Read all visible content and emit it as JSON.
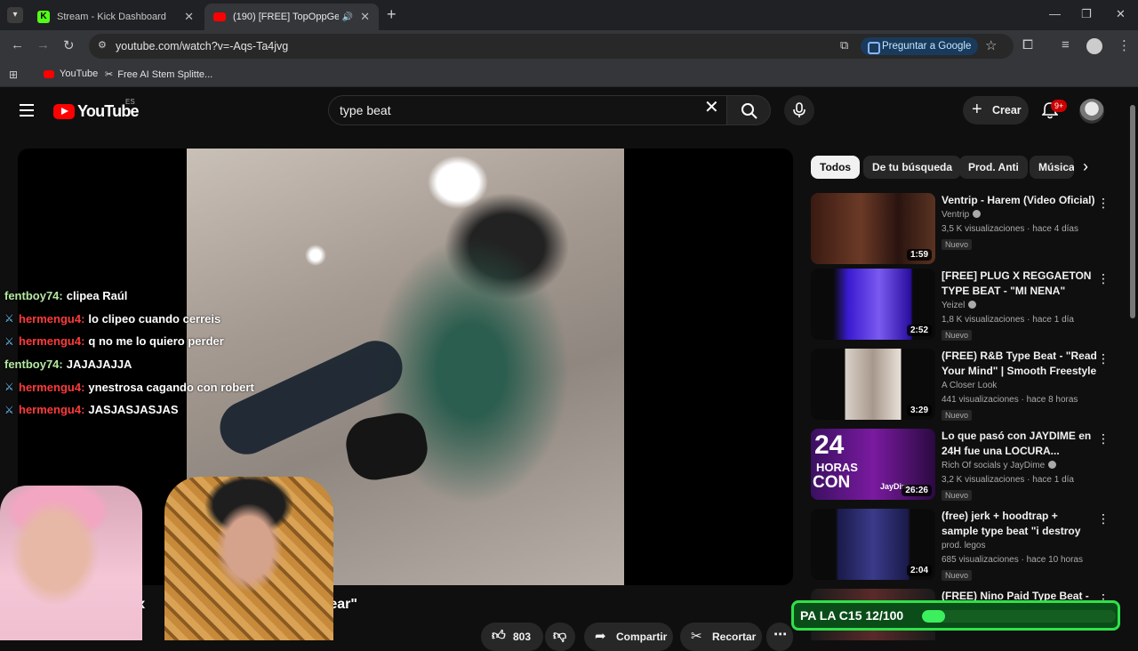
{
  "browser": {
    "tabs": [
      {
        "title": "Stream - Kick Dashboard",
        "favicon": "kick-icon",
        "color": "#53fc18"
      },
      {
        "title": "(190) [FREE] TopOppGen x I",
        "favicon": "youtube-icon",
        "color": "#ff0000"
      }
    ],
    "url": "youtube.com/watch?v=-Aqs-Ta4jvg",
    "ask_google": "Preguntar a Google",
    "bookmarks": [
      "YouTube",
      "Free AI Stem Splitte..."
    ]
  },
  "youtube": {
    "logo_text": "YouTube",
    "country": "ES",
    "search_value": "type beat",
    "create_label": "Crear",
    "notifications": "9+"
  },
  "chat": [
    {
      "user": "fentboy74:",
      "msg": "clipea Raúl",
      "color": "green",
      "icon": false
    },
    {
      "user": "hermengu4:",
      "msg": "lo clipeo cuando cerreis",
      "color": "red",
      "icon": true
    },
    {
      "user": "hermengu4:",
      "msg": "q no me lo quiero perder",
      "color": "red",
      "icon": true
    },
    {
      "user": "fentboy74:",
      "msg": "JAJAJAJJA",
      "color": "green",
      "icon": false
    },
    {
      "user": "hermengu4:",
      "msg": "ynestrosa cagando con robert",
      "color": "red",
      "icon": true
    },
    {
      "user": "hermengu4:",
      "msg": "JASJASJASJAS",
      "color": "red",
      "icon": true
    }
  ],
  "video": {
    "title_fragment_1": "n x",
    "title_fragment_2": "fear\"",
    "likes": "803",
    "share": "Compartir",
    "clip": "Recortar"
  },
  "chips": [
    "Todos",
    "De tu búsqueda",
    "Prod. Anti",
    "Música"
  ],
  "recommendations": [
    {
      "title": "Ventrip - Harem (Video Oficial)",
      "channel": "Ventrip",
      "verified": true,
      "meta": "3,5 K visualizaciones · hace 4 días",
      "badge": "Nuevo",
      "duration": "1:59"
    },
    {
      "title": "[FREE] PLUG X REGGAETON TYPE BEAT - \"MI NENA\"",
      "channel": "Yeizel",
      "verified": true,
      "meta": "1,8 K visualizaciones · hace 1 día",
      "badge": "Nuevo",
      "duration": "2:52"
    },
    {
      "title": "(FREE) R&B Type Beat - \"Read Your Mind\" | Smooth Freestyle ...",
      "channel": "A Closer Look",
      "verified": false,
      "meta": "441 visualizaciones · hace 8 horas",
      "badge": "Nuevo",
      "duration": "3:29"
    },
    {
      "title": "Lo que pasó con JAYDIME en 24H fue una LOCURA...",
      "channel": "Rich Of socials y JayDime",
      "verified": true,
      "meta": "3,2 K visualizaciones · hace 1 día",
      "badge": "Nuevo",
      "duration": "26:26"
    },
    {
      "title": "(free) jerk + hoodtrap + sample type beat \"i destroy myself for ...",
      "channel": "prod. legos",
      "verified": false,
      "meta": "685 visualizaciones · hace 10 horas",
      "badge": "Nuevo",
      "duration": "2:04"
    },
    {
      "title": "(FREE) Nino Paid Type Beat - ...",
      "channel": "",
      "verified": false,
      "meta": "",
      "badge": "",
      "duration": ""
    }
  ],
  "thumb_art": {
    "thumb_24_text": "24",
    "thumb_horas_text": "HORAS",
    "thumb_con_text": "CON",
    "thumb_jaydime_text": "JayDim"
  },
  "goal": {
    "text": "PA LA C15 12/100",
    "current": 12,
    "target": 100,
    "border_color": "#2ee24a"
  }
}
